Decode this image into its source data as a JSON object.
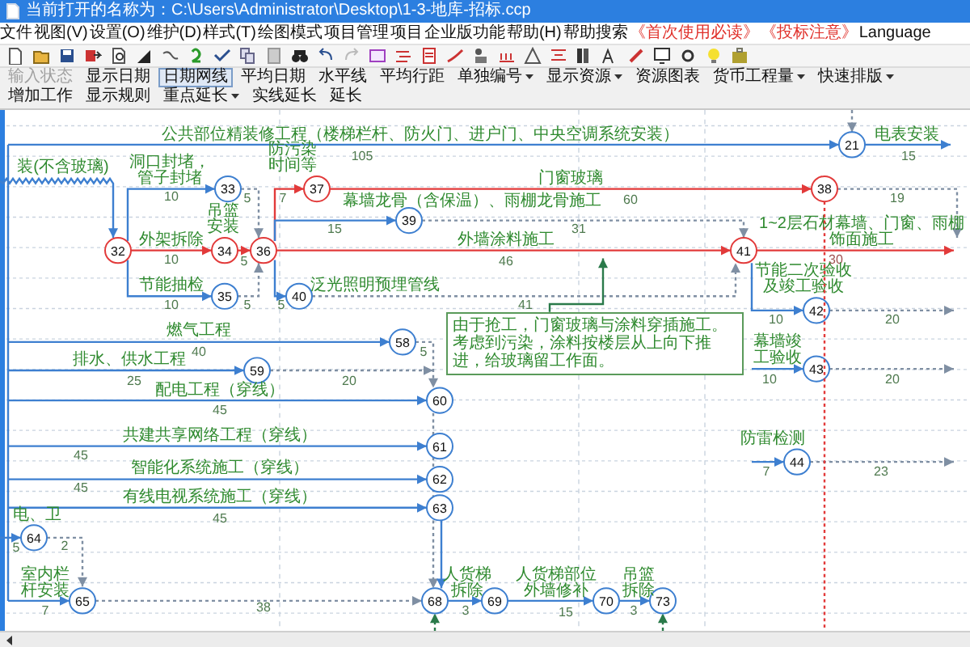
{
  "window": {
    "title": "当前打开的名称为：C:\\Users\\Administrator\\Desktop\\1-3-地库-招标.ccp"
  },
  "menu": [
    {
      "label": "文件",
      "highlight": false
    },
    {
      "label": "视图(V)",
      "highlight": false
    },
    {
      "label": "设置(O)",
      "highlight": false
    },
    {
      "label": "维护(D)",
      "highlight": false
    },
    {
      "label": "样式(T)",
      "highlight": false
    },
    {
      "label": "绘图模式",
      "highlight": false
    },
    {
      "label": "项目管理",
      "highlight": false
    },
    {
      "label": "项目",
      "highlight": false
    },
    {
      "label": "企业版功能",
      "highlight": false
    },
    {
      "label": "帮助(H)",
      "highlight": false
    },
    {
      "label": "帮助搜索",
      "highlight": false
    },
    {
      "label": "《首次使用必读》",
      "highlight": true
    },
    {
      "label": "《投标注意》",
      "highlight": true
    },
    {
      "label": "Language",
      "highlight": false
    }
  ],
  "toolbar": [
    {
      "label": "输入状态",
      "kind": "button",
      "disabled": true,
      "selected": false
    },
    {
      "label": "显示日期",
      "kind": "button",
      "disabled": false,
      "selected": false
    },
    {
      "label": "日期网线",
      "kind": "button",
      "disabled": false,
      "selected": true
    },
    {
      "label": "平均日期",
      "kind": "button",
      "disabled": false,
      "selected": false
    },
    {
      "label": "水平线",
      "kind": "button",
      "disabled": false,
      "selected": false
    },
    {
      "label": "平均行距",
      "kind": "button",
      "disabled": false,
      "selected": false
    },
    {
      "label": "单独编号",
      "kind": "dropdown",
      "disabled": false,
      "selected": false
    },
    {
      "label": "显示资源",
      "kind": "dropdown",
      "disabled": false,
      "selected": false
    },
    {
      "label": "资源图表",
      "kind": "button",
      "disabled": false,
      "selected": false
    },
    {
      "label": "货币工程量",
      "kind": "dropdown",
      "disabled": false,
      "selected": false
    },
    {
      "label": "快速排版",
      "kind": "dropdown",
      "disabled": false,
      "selected": false
    },
    {
      "label": "增加工作",
      "kind": "button",
      "disabled": false,
      "selected": false
    },
    {
      "label": "显示规则",
      "kind": "button",
      "disabled": false,
      "selected": false
    },
    {
      "label": "重点延长",
      "kind": "dropdown",
      "disabled": false,
      "selected": false
    },
    {
      "label": "实线延长",
      "kind": "button",
      "disabled": false,
      "selected": false
    },
    {
      "label": "延长",
      "kind": "button",
      "disabled": false,
      "selected": false
    }
  ],
  "diagram": {
    "nodes": [
      {
        "label": "21",
        "critical": false
      },
      {
        "label": "33",
        "critical": false
      },
      {
        "label": "37",
        "critical": true
      },
      {
        "label": "38",
        "critical": true
      },
      {
        "label": "39",
        "critical": false
      },
      {
        "label": "32",
        "critical": true
      },
      {
        "label": "34",
        "critical": true
      },
      {
        "label": "36",
        "critical": true
      },
      {
        "label": "41",
        "critical": true
      },
      {
        "label": "35",
        "critical": false
      },
      {
        "label": "40",
        "critical": false
      },
      {
        "label": "42",
        "critical": false
      },
      {
        "label": "43",
        "critical": false
      },
      {
        "label": "44",
        "critical": false
      },
      {
        "label": "58",
        "critical": false
      },
      {
        "label": "59",
        "critical": false
      },
      {
        "label": "60",
        "critical": false
      },
      {
        "label": "61",
        "critical": false
      },
      {
        "label": "62",
        "critical": false
      },
      {
        "label": "63",
        "critical": false
      },
      {
        "label": "64",
        "critical": false
      },
      {
        "label": "65",
        "critical": false
      },
      {
        "label": "68",
        "critical": false
      },
      {
        "label": "69",
        "critical": false
      },
      {
        "label": "70",
        "critical": false
      },
      {
        "label": "73",
        "critical": false
      }
    ],
    "activities": [
      {
        "kind": "work",
        "name": "公共部位精装修工程（楼梯栏杆、防火门、进户门、中央空调系统安装）",
        "duration": "105"
      },
      {
        "kind": "work",
        "name": "电表安装",
        "duration": "15"
      },
      {
        "kind": "float",
        "name": "装(不含玻璃)"
      },
      {
        "kind": "work",
        "name": "洞口封堵，管子封堵",
        "duration": "10"
      },
      {
        "kind": "critical",
        "name": "外架拆除",
        "duration": "10"
      },
      {
        "kind": "work",
        "name": "节能抽检",
        "duration": "10"
      },
      {
        "kind": "dummy",
        "duration": "5"
      },
      {
        "kind": "dummy",
        "duration": "5"
      },
      {
        "kind": "critical",
        "name": "吊篮安装",
        "duration": "5"
      },
      {
        "kind": "critical",
        "name": "防污染时间等",
        "duration": "7"
      },
      {
        "kind": "critical",
        "name": "门窗玻璃",
        "duration": "60"
      },
      {
        "kind": "work",
        "name": "幕墙龙骨（含保温）、雨棚龙骨施工",
        "duration": "15"
      },
      {
        "kind": "dummy",
        "duration": "31"
      },
      {
        "kind": "critical",
        "name": "外墙涂料施工",
        "duration": "46"
      },
      {
        "kind": "work",
        "name": "泛光照明预埋管线",
        "duration": "5"
      },
      {
        "kind": "dummy",
        "duration": "41"
      },
      {
        "kind": "dummy",
        "duration": "19"
      },
      {
        "kind": "critical",
        "name": "1~2层石材幕墙、门窗、雨棚饰面施工"
      },
      {
        "kind": "critical_dummy",
        "duration": "30"
      },
      {
        "kind": "work",
        "name": "节能二次验收及竣工验收",
        "duration": "10"
      },
      {
        "kind": "dummy",
        "duration": "20"
      },
      {
        "kind": "work",
        "name": "幕墙竣工验收",
        "duration": "10"
      },
      {
        "kind": "dummy",
        "duration": "20"
      },
      {
        "kind": "work",
        "name": "防雷检测",
        "duration": "7"
      },
      {
        "kind": "dummy",
        "duration": "23"
      },
      {
        "kind": "work",
        "name": "燃气工程",
        "duration": "40"
      },
      {
        "kind": "work",
        "name": "排水、供水工程",
        "duration": "25"
      },
      {
        "kind": "dummy",
        "duration": "5"
      },
      {
        "kind": "dummy",
        "duration": "20"
      },
      {
        "kind": "work",
        "name": "配电工程（穿线）",
        "duration": "45"
      },
      {
        "kind": "work",
        "name": "共建共享网络工程（穿线）",
        "duration": "45"
      },
      {
        "kind": "work",
        "name": "智能化系统施工（穿线）",
        "duration": "45"
      },
      {
        "kind": "work",
        "name": "有线电视系统施工（穿线）",
        "duration": "45"
      },
      {
        "kind": "work",
        "name": "电、卫",
        "duration": "5"
      },
      {
        "kind": "dummy",
        "duration": "2"
      },
      {
        "kind": "work",
        "name": "室内栏杆安装",
        "duration": "7"
      },
      {
        "kind": "dummy",
        "duration": "38"
      },
      {
        "kind": "work",
        "name": "人货梯拆除",
        "duration": "3"
      },
      {
        "kind": "work",
        "name": "人货梯部位外墙修补",
        "duration": "15"
      },
      {
        "kind": "work",
        "name": "吊篮拆除",
        "duration": "3"
      }
    ],
    "note": {
      "text": "由于抢工，门窗玻璃与涂料穿插施工。考虑到污染，涂料按楼层从上向下推进，给玻璃留工作面。"
    }
  }
}
